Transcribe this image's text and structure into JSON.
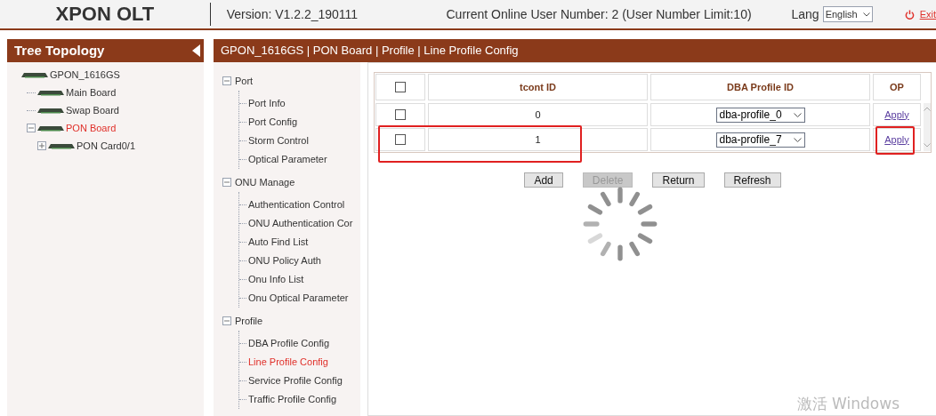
{
  "header": {
    "logo": "XPON OLT",
    "version": "Version: V1.2.2_190111",
    "online_users": "Current Online User Number: 2 (User Number Limit:10)",
    "lang_label": "Lang",
    "lang_value": "English",
    "exit": "Exit"
  },
  "sidebar": {
    "title": "Tree Topology",
    "tree": [
      {
        "label": "GPON_1616GS",
        "selected": false,
        "children": [
          {
            "label": "Main Board",
            "selected": false
          },
          {
            "label": "Swap Board",
            "selected": false
          },
          {
            "label": "PON Board",
            "selected": true,
            "expanded": true,
            "children": [
              {
                "label": "PON Card0/1",
                "selected": false,
                "expanded": false
              }
            ]
          }
        ]
      }
    ]
  },
  "breadcrumb": "GPON_1616GS | PON Board | Profile | Line Profile Config",
  "menu": [
    {
      "label": "Port",
      "expanded": true,
      "children": [
        {
          "label": "Port Info",
          "selected": false
        },
        {
          "label": "Port Config",
          "selected": false
        },
        {
          "label": "Storm Control",
          "selected": false
        },
        {
          "label": "Optical Parameter",
          "selected": false
        }
      ]
    },
    {
      "label": "ONU Manage",
      "expanded": true,
      "children": [
        {
          "label": "Authentication Control",
          "selected": false
        },
        {
          "label": "ONU Authentication Cor",
          "selected": false
        },
        {
          "label": "Auto Find List",
          "selected": false
        },
        {
          "label": "ONU Policy Auth",
          "selected": false
        },
        {
          "label": "Onu Info List",
          "selected": false
        },
        {
          "label": "Onu Optical Parameter",
          "selected": false
        }
      ]
    },
    {
      "label": "Profile",
      "expanded": true,
      "children": [
        {
          "label": "DBA Profile Config",
          "selected": false
        },
        {
          "label": "Line Profile Config",
          "selected": true
        },
        {
          "label": "Service Profile Config",
          "selected": false
        },
        {
          "label": "Traffic Profile Config",
          "selected": false
        }
      ]
    }
  ],
  "table": {
    "header_checked": false,
    "columns": [
      "tcont ID",
      "DBA Profile ID",
      "OP"
    ],
    "rows": [
      {
        "checked": false,
        "tcont_id": "0",
        "dba_profile": "dba-profile_0",
        "op": "Apply",
        "highlight_id": false,
        "highlight_op": false
      },
      {
        "checked": false,
        "tcont_id": "1",
        "dba_profile": "dba-profile_7",
        "op": "Apply",
        "highlight_id": true,
        "highlight_op": true
      }
    ]
  },
  "buttons": [
    {
      "label": "Add",
      "disabled": false
    },
    {
      "label": "Delete",
      "disabled": true
    },
    {
      "label": "Return",
      "disabled": false
    },
    {
      "label": "Refresh",
      "disabled": false
    }
  ],
  "loading": true,
  "os_watermark": "激活 Windows"
}
